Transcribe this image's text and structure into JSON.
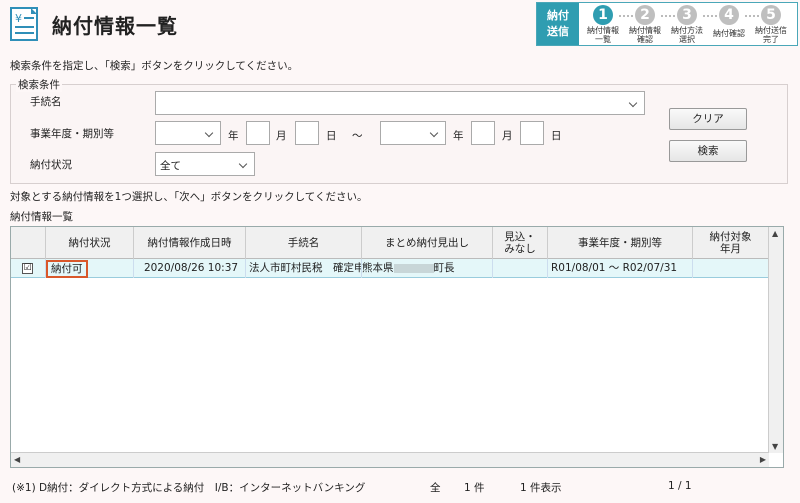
{
  "header": {
    "title": "納付情報一覧",
    "icon": "document-yen-icon"
  },
  "steps": {
    "current_label_1": "納付",
    "current_label_2": "送信",
    "items": [
      {
        "num": "1",
        "l1": "納付情報",
        "l2": "一覧"
      },
      {
        "num": "2",
        "l1": "納付情報",
        "l2": "確認"
      },
      {
        "num": "3",
        "l1": "納付方法",
        "l2": "選択"
      },
      {
        "num": "4",
        "l1": "納付確認",
        "l2": ""
      },
      {
        "num": "5",
        "l1": "納付送信",
        "l2": "完了"
      }
    ]
  },
  "instructions": {
    "search": "検索条件を指定し、「検索」ボタンをクリックしてください。",
    "select": "対象とする納付情報を1つ選択し、「次へ」ボタンをクリックしてください。"
  },
  "search": {
    "legend": "検索条件",
    "procedure_label": "手続名",
    "procedure_value": "",
    "period_label": "事業年度・期別等",
    "year": "年",
    "month": "月",
    "day": "日",
    "tilde": "～",
    "status_label": "納付状況",
    "status_value": "全て",
    "clear_button": "クリア",
    "search_button": "検索"
  },
  "list": {
    "title": "納付情報一覧",
    "columns": [
      "納付状況",
      "納付情報作成日時",
      "手続名",
      "まとめ納付見出し",
      "見込・\nみなし",
      "事業年度・期別等",
      "納付対象\n年月"
    ],
    "rows": [
      {
        "checked": "☑",
        "status": "納付可",
        "created": "2020/08/26 10:37",
        "procedure": "法人市町村民税　確定申",
        "heading_pre": "熊本県",
        "heading_post": "町長",
        "estimate": "",
        "period": "R01/08/01 ～ R02/07/31",
        "target": ""
      }
    ]
  },
  "footer": {
    "legend": "(※1) D納付：ダイレクト方式による納付　I/B：インターネットバンキング",
    "total": "全",
    "total_count": "1 件",
    "shown": "1 件表示",
    "page": "1 / 1"
  },
  "colors": {
    "accent": "#2f9db1",
    "highlight_border": "#d9582b",
    "row_bg": "#e4f7f9"
  }
}
